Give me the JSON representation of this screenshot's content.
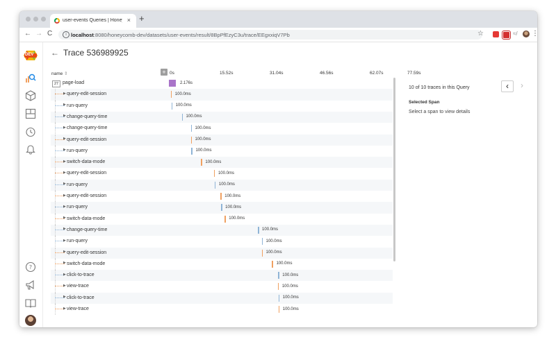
{
  "browser": {
    "tab_title": "user-events Queries | Honeyc",
    "tab_close": "×",
    "new_tab": "+",
    "url_host": "localhost",
    "url_rest": ":8080/honeycomb-dev/datasets/user-events/result/8BpPfEzyC3u/trace/EEgxxiqV7Pb",
    "back": "←",
    "forward": "→",
    "reload": "C",
    "star": "☆",
    "menu": "⋮"
  },
  "colors": {
    "accent": "#f0a060",
    "blue_bar": "#8fb4d6",
    "root_bar": "#a974c9",
    "sidebar_icon": "#777777"
  },
  "sidebar": {
    "logo_text": "DEV",
    "items": [
      {
        "icon": "query-icon"
      },
      {
        "icon": "dataset-cube-icon"
      },
      {
        "icon": "boards-icon"
      },
      {
        "icon": "history-icon"
      },
      {
        "icon": "triggers-bell-icon"
      }
    ],
    "bottom_items": [
      {
        "icon": "help-icon"
      },
      {
        "icon": "announcements-icon"
      },
      {
        "icon": "docs-book-icon"
      },
      {
        "icon": "user-avatar"
      }
    ]
  },
  "trace": {
    "back_arrow": "←",
    "title": "Trace 536989925",
    "name_header": "name",
    "expand_label": "+",
    "ticks": [
      "0s",
      "15.52s",
      "31.04s",
      "46.56s",
      "62.07s",
      "77.59s"
    ],
    "root": {
      "count": "27",
      "name": "page-load",
      "duration": "2.176s",
      "start": 0,
      "width": 2.176
    },
    "spans": [
      {
        "name": "query-edit-session",
        "duration": "100.0ms",
        "start": 0.6,
        "color": "#f0a060"
      },
      {
        "name": "run-query",
        "duration": "100.0ms",
        "start": 0.8,
        "color": "#8fb4d6"
      },
      {
        "name": "change-query-time",
        "duration": "100.0ms",
        "start": 4.0,
        "color": "#8fb4d6"
      },
      {
        "name": "change-query-time",
        "duration": "100.0ms",
        "start": 6.8,
        "color": "#8fb4d6"
      },
      {
        "name": "query-edit-session",
        "duration": "100.0ms",
        "start": 6.8,
        "color": "#f0a060"
      },
      {
        "name": "run-query",
        "duration": "100.0ms",
        "start": 7.0,
        "color": "#8fb4d6"
      },
      {
        "name": "switch-data-mode",
        "duration": "100.0ms",
        "start": 10.0,
        "color": "#f0a060"
      },
      {
        "name": "query-edit-session",
        "duration": "100.0ms",
        "start": 14.0,
        "color": "#f0a060"
      },
      {
        "name": "run-query",
        "duration": "100.0ms",
        "start": 14.2,
        "color": "#8fb4d6"
      },
      {
        "name": "query-edit-session",
        "duration": "100.0ms",
        "start": 16.0,
        "color": "#f0a060"
      },
      {
        "name": "run-query",
        "duration": "100.0ms",
        "start": 16.2,
        "color": "#8fb4d6"
      },
      {
        "name": "switch-data-mode",
        "duration": "100.0ms",
        "start": 17.3,
        "color": "#f0a060"
      },
      {
        "name": "change-query-time",
        "duration": "100.0ms",
        "start": 27.6,
        "color": "#8fb4d6"
      },
      {
        "name": "run-query",
        "duration": "100.0ms",
        "start": 28.8,
        "color": "#8fb4d6"
      },
      {
        "name": "query-edit-session",
        "duration": "100.0ms",
        "start": 28.8,
        "color": "#f0a060"
      },
      {
        "name": "switch-data-mode",
        "duration": "100.0ms",
        "start": 32.0,
        "color": "#f0a060"
      },
      {
        "name": "click-to-trace",
        "duration": "100.0ms",
        "start": 33.9,
        "color": "#8fb4d6"
      },
      {
        "name": "view-trace",
        "duration": "100.0ms",
        "start": 33.8,
        "color": "#f0a060"
      },
      {
        "name": "click-to-trace",
        "duration": "100.0ms",
        "start": 34.0,
        "color": "#8fb4d6"
      },
      {
        "name": "view-trace",
        "duration": "100.0ms",
        "start": 34.0,
        "color": "#f0a060"
      }
    ]
  },
  "panel": {
    "count_text": "10 of 10 traces in this Query",
    "prev": "‹",
    "next": "›",
    "selected_label": "Selected Span",
    "hint": "Select a span to view details"
  }
}
